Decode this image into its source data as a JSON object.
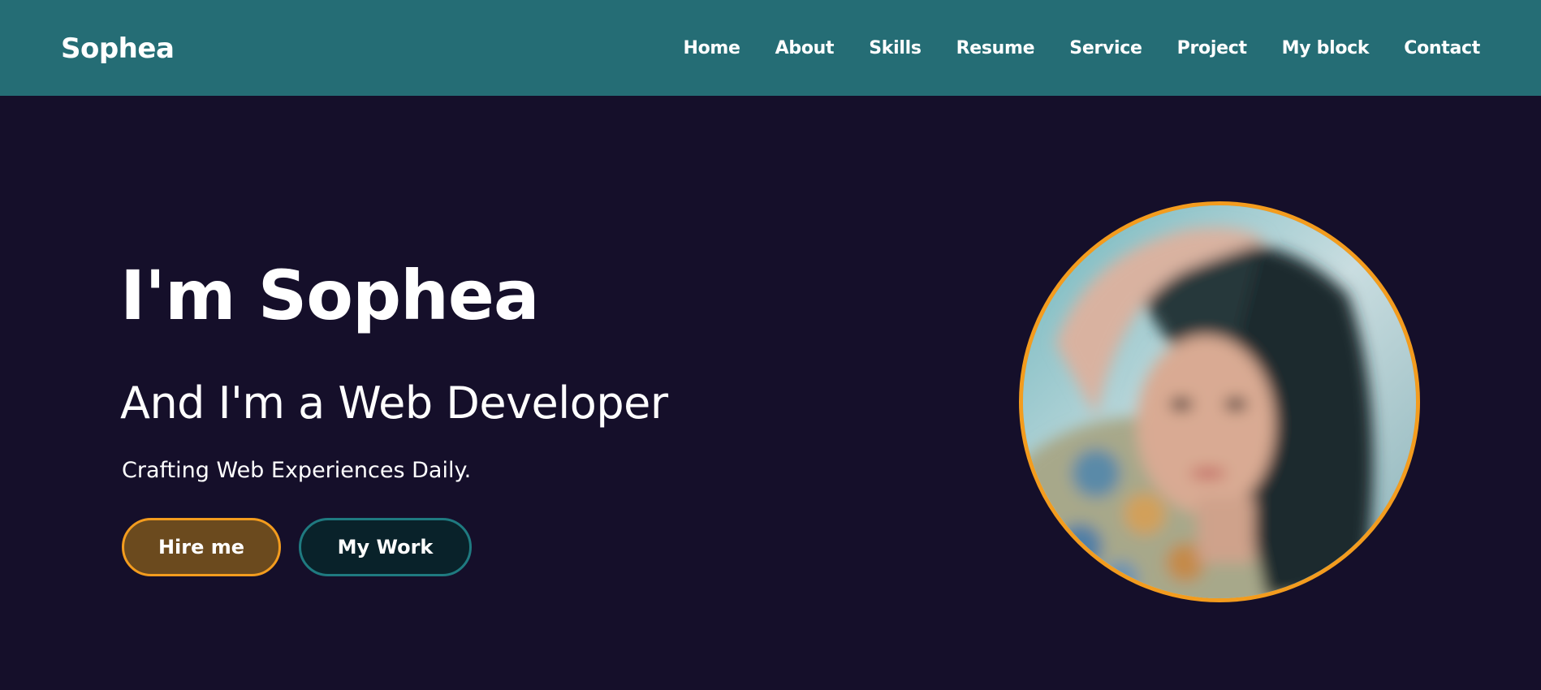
{
  "navbar": {
    "logo": "Sophea",
    "links": [
      "Home",
      "About",
      "Skills",
      "Resume",
      "Service",
      "Project",
      "My block",
      "Contact"
    ]
  },
  "hero": {
    "title": "I'm Sophea",
    "subtitle": "And I'm a Web Developer",
    "tagline": "Crafting Web Experiences Daily.",
    "hire_label": "Hire me",
    "work_label": "My Work",
    "avatar_alt": "profile photo"
  },
  "colors": {
    "navbar_bg": "#256d75",
    "page_bg": "#150f2a",
    "accent_orange": "#f39c1e",
    "accent_teal": "#1f7a80"
  }
}
